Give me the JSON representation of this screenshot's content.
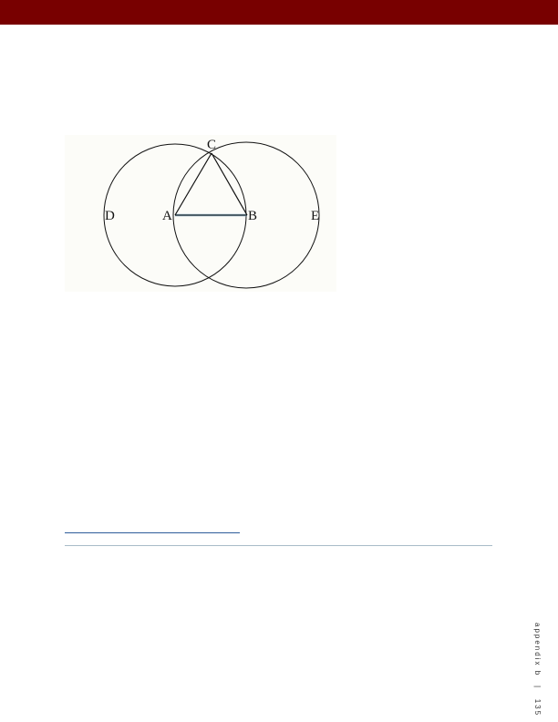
{
  "header": {
    "color": "#780000"
  },
  "figure": {
    "labels": {
      "C": "C",
      "D": "D",
      "A": "A",
      "B": "B",
      "E": "E"
    }
  },
  "footer": {
    "section": "appendix b",
    "separator": "|",
    "page_number": "135"
  }
}
